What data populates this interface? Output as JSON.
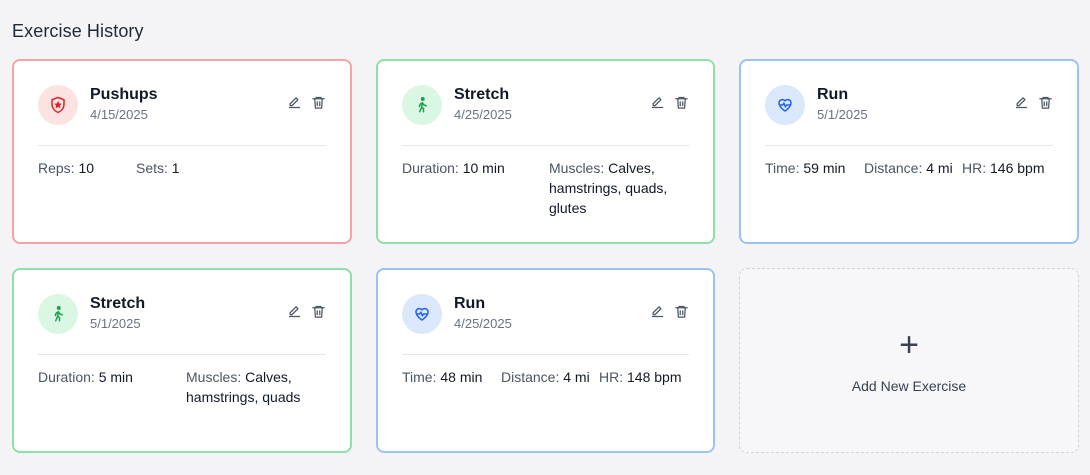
{
  "page": {
    "title": "Exercise History"
  },
  "colors": {
    "strength_border": "#f4a4a4",
    "flex_border": "#8ee0a6",
    "cardio_border": "#9bc2f5",
    "strength_icon": "#dc2626",
    "flex_icon": "#16a34a",
    "cardio_icon": "#2563eb"
  },
  "cards": [
    {
      "kind": "strength",
      "icon": "shield-star-icon",
      "name": "Pushups",
      "date": "4/15/2025",
      "stats": [
        {
          "label": "Reps:",
          "value": "10"
        },
        {
          "label": "Sets:",
          "value": "1"
        }
      ]
    },
    {
      "kind": "flex",
      "icon": "walking-person-icon",
      "name": "Stretch",
      "date": "4/25/2025",
      "stats": [
        {
          "label": "Duration:",
          "value": "10 min"
        },
        {
          "label": "Muscles:",
          "value": "Calves, hamstrings, quads, glutes"
        }
      ]
    },
    {
      "kind": "cardio",
      "icon": "heart-pulse-icon",
      "name": "Run",
      "date": "5/1/2025",
      "stats": [
        {
          "label": "Time:",
          "value": "59 min"
        },
        {
          "label": "Distance:",
          "value": "4 mi"
        },
        {
          "label": "HR:",
          "value": "146 bpm"
        }
      ]
    },
    {
      "kind": "flex",
      "icon": "walking-person-icon",
      "name": "Stretch",
      "date": "5/1/2025",
      "stats": [
        {
          "label": "Duration:",
          "value": "5 min"
        },
        {
          "label": "Muscles:",
          "value": "Calves, hamstrings, quads"
        }
      ]
    },
    {
      "kind": "cardio",
      "icon": "heart-pulse-icon",
      "name": "Run",
      "date": "4/25/2025",
      "stats": [
        {
          "label": "Time:",
          "value": "48 min"
        },
        {
          "label": "Distance:",
          "value": "4 mi"
        },
        {
          "label": "HR:",
          "value": "148 bpm"
        }
      ]
    }
  ],
  "add_card": {
    "plus": "+",
    "label": "Add New Exercise"
  }
}
